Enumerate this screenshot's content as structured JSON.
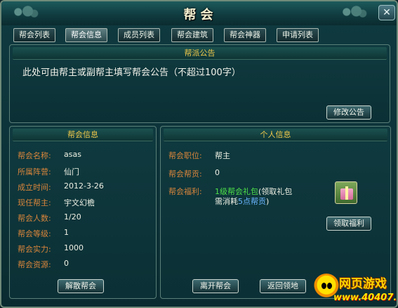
{
  "window": {
    "title": "帮会",
    "close_glyph": "✕"
  },
  "tabs": [
    {
      "label": "帮会列表"
    },
    {
      "label": "帮会信息"
    },
    {
      "label": "成员列表"
    },
    {
      "label": "帮会建筑"
    },
    {
      "label": "帮会神器"
    },
    {
      "label": "申请列表"
    }
  ],
  "announcement": {
    "header": "帮派公告",
    "text": "此处可由帮主或副帮主填写帮会公告（不超过100字）",
    "edit_button": "修改公告"
  },
  "guild_info": {
    "header": "帮会信息",
    "rows": [
      {
        "label": "帮会名称:",
        "value": "asas"
      },
      {
        "label": "所属阵营:",
        "value": "仙门"
      },
      {
        "label": "成立时间:",
        "value": "2012-3-26"
      },
      {
        "label": "现任帮主:",
        "value": "宇文幻檐"
      },
      {
        "label": "帮会人数:",
        "value": "1/20"
      },
      {
        "label": "帮会等级:",
        "value": "1"
      },
      {
        "label": "帮会实力:",
        "value": "1000"
      },
      {
        "label": "帮会资源:",
        "value": "0"
      }
    ],
    "disband_button": "解散帮会"
  },
  "personal_info": {
    "header": "个人信息",
    "position_label": "帮会职位:",
    "position_value": "帮主",
    "contribution_label": "帮会帮贡:",
    "contribution_value": "0",
    "welfare_label": "帮会福利:",
    "welfare_line1_green": "1级帮会礼包",
    "welfare_line1_white": "(领取礼包",
    "welfare_line2_pre": "需消耗",
    "welfare_line2_blue": "5点帮贡",
    "welfare_line2_post": ")",
    "claim_button": "领取福利",
    "gift_icon": "gift-box-icon",
    "leave_button": "离开帮会",
    "return_button": "返回领地"
  },
  "watermark": {
    "text": "网页游戏",
    "url": "www.40407.com"
  },
  "colors": {
    "label": "#d9853b",
    "header": "#f0c84a",
    "green": "#4fe04a",
    "blue": "#6ab5ff"
  }
}
